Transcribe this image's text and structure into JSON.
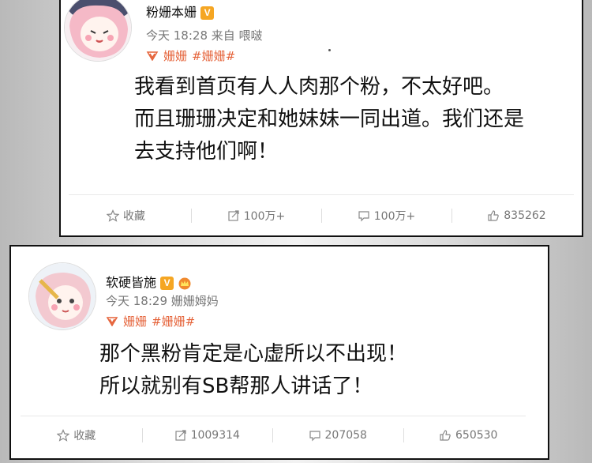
{
  "posts": [
    {
      "username": "粉姗本姗",
      "time": "今天 18:28",
      "source": "来自 喂啵",
      "topics": [
        "姗姗",
        "#姗姗#"
      ],
      "content": [
        "我看到首页有人人肉那个粉，不太好吧。",
        "而且珊珊决定和她妹妹一同出道。我们还是",
        "去支持他们啊！"
      ],
      "actions": {
        "favorite": "收藏",
        "repost": "100万+",
        "comment": "100万+",
        "like": "835262"
      }
    },
    {
      "username": "软硬皆施",
      "time": "今天 18:29",
      "source": "姗姗姆妈",
      "topics": [
        "姗姗",
        "#姗姗#"
      ],
      "content": [
        "那个黑粉肯定是心虚所以不出现！",
        "所以就别有SB帮那人讲话了！"
      ],
      "actions": {
        "favorite": "收藏",
        "repost": "1009314",
        "comment": "207058",
        "like": "650530"
      }
    }
  ],
  "colors": {
    "topic": "#e5633a",
    "verified": "#f5a623",
    "meta": "#777777"
  }
}
